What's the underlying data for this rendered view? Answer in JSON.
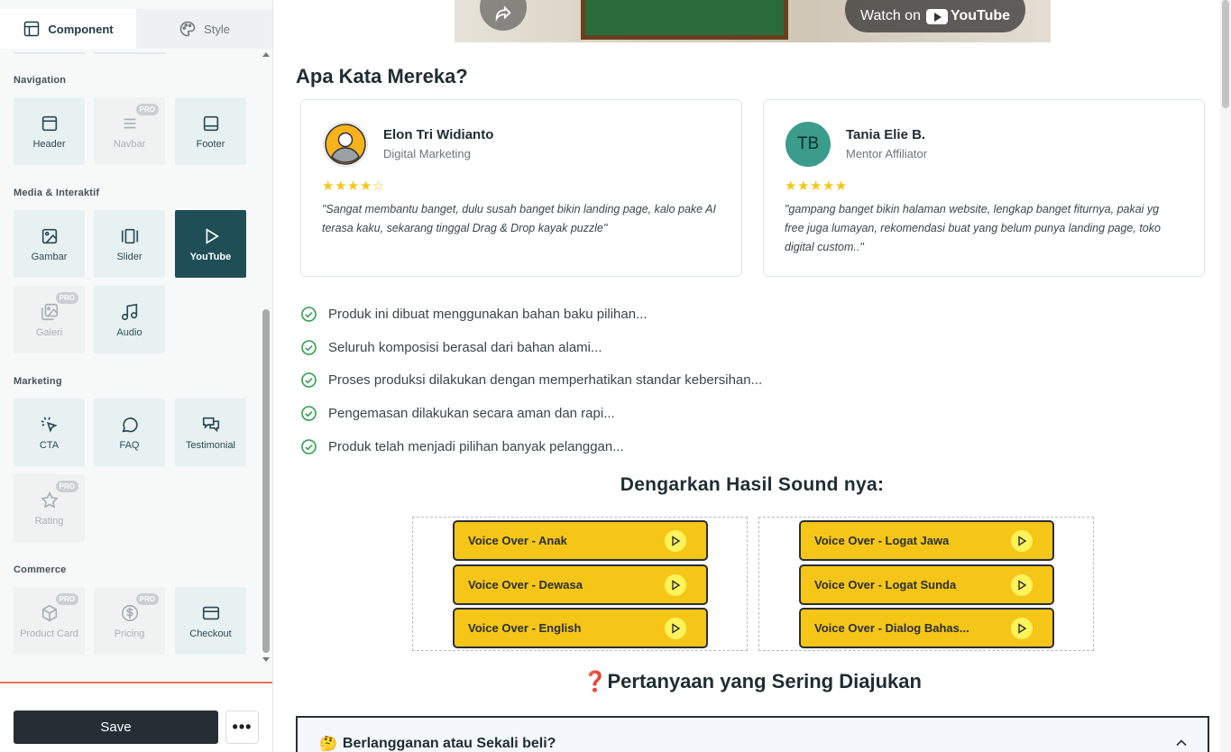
{
  "sidebar": {
    "tabs": [
      {
        "label": "Component",
        "icon": "layout-icon",
        "active": true
      },
      {
        "label": "Style",
        "icon": "palette-icon",
        "active": false
      }
    ],
    "sections": {
      "navigation": {
        "title": "Navigation",
        "items": [
          {
            "label": "Header",
            "icon": "header-icon",
            "pro": false
          },
          {
            "label": "Navbar",
            "icon": "menu-icon",
            "pro": true
          },
          {
            "label": "Footer",
            "icon": "footer-icon",
            "pro": false
          }
        ]
      },
      "media": {
        "title": "Media & Interaktif",
        "items": [
          {
            "label": "Gambar",
            "icon": "image-icon",
            "pro": false
          },
          {
            "label": "Slider",
            "icon": "slider-icon",
            "pro": false
          },
          {
            "label": "YouTube",
            "icon": "play-icon",
            "pro": false,
            "selected": true
          },
          {
            "label": "Galeri",
            "icon": "gallery-icon",
            "pro": true
          },
          {
            "label": "Audio",
            "icon": "music-icon",
            "pro": false
          }
        ]
      },
      "marketing": {
        "title": "Marketing",
        "items": [
          {
            "label": "CTA",
            "icon": "cursor-click-icon",
            "pro": false
          },
          {
            "label": "FAQ",
            "icon": "chat-bubble-icon",
            "pro": false
          },
          {
            "label": "Testimonial",
            "icon": "chat-quote-icon",
            "pro": false
          },
          {
            "label": "Rating",
            "icon": "star-icon",
            "pro": true
          }
        ]
      },
      "commerce": {
        "title": "Commerce",
        "items": [
          {
            "label": "Product Card",
            "icon": "box-icon",
            "pro": true
          },
          {
            "label": "Pricing",
            "icon": "dollar-icon",
            "pro": true
          },
          {
            "label": "Checkout",
            "icon": "card-icon",
            "pro": false
          }
        ]
      }
    },
    "pro_badge": "PRO",
    "save_label": "Save",
    "more_label": "•••"
  },
  "video": {
    "watch_on": "Watch on",
    "platform": "YouTube"
  },
  "testimonials": {
    "heading": "Apa Kata Mereka?",
    "items": [
      {
        "name": "Elon Tri Widianto",
        "role": "Digital Marketing",
        "stars": "★★★★☆",
        "rating": 4,
        "quote": "\"Sangat membantu banget, dulu susah banget bikin landing page, kalo pake AI terasa kaku, sekarang tinggal Drag & Drop kayak puzzle\""
      },
      {
        "name": "Tania Elie B.",
        "role": "Mentor Affiliator",
        "initials": "TB",
        "stars": "★★★★★",
        "rating": 5,
        "quote": "\"gampang banget bikin halaman website, lengkap banget fiturnya, pakai yg free juga lumayan, rekomendasi buat yang belum punya landing page, toko digital custom..\""
      }
    ]
  },
  "checklist": [
    "Produk ini dibuat menggunakan bahan baku pilihan...",
    "Seluruh komposisi berasal dari bahan alami...",
    "Proses produksi dilakukan dengan memperhatikan standar kebersihan...",
    "Pengemasan dilakukan secara aman dan rapi...",
    "Produk telah menjadi pilihan banyak pelanggan..."
  ],
  "audio": {
    "heading": "Dengarkan Hasil Sound nya:",
    "left": [
      "Voice Over - Anak",
      "Voice Over - Dewasa",
      "Voice Over - English"
    ],
    "right": [
      "Voice Over - Logat Jawa",
      "Voice Over - Logat Sunda",
      "Voice Over - Dialog Bahas..."
    ]
  },
  "faq": {
    "heading_mark": "❓",
    "heading": "Pertanyaan yang Sering Diajukan",
    "first_item": {
      "emoji": "🤔",
      "label": "Berlangganan atau Sekali beli?"
    }
  },
  "colors": {
    "selected_tile": "#1f4e57",
    "audio_button": "#f5c518",
    "check_green": "#2e9e4f",
    "avatar_teal": "#3b9c8c",
    "divider_accent": "#e8735a"
  }
}
